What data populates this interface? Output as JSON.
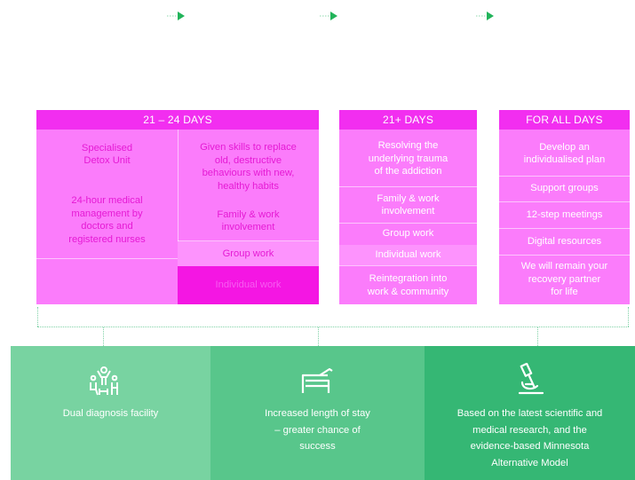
{
  "colors": {
    "header_pink": "#f22ef0",
    "cell_pink": "#fb7cfb",
    "cell_pink_alt": "#fd93fd",
    "hot_pink": "#f416e3",
    "text_magenta": "#e51ad4",
    "arrow_green": "#22b45a",
    "panel_1": "#78d3a1",
    "panel_2": "#58c68b",
    "panel_3": "#35b774"
  },
  "col1": {
    "header": "21 – 24 DAYS",
    "left_top": "Specialised\nDetox Unit",
    "left_mid": "24-hour medical\nmanagement by\ndoctors and\nregistered nurses",
    "right_top": "Given skills to replace\nold, destructive\nbehaviours with new,\nhealthy habits",
    "right_mid": "Family & work\ninvolvement",
    "right_group": "Group work",
    "right_individual": "Individual work"
  },
  "col2": {
    "header": "21+ DAYS",
    "items": [
      "Resolving the\nunderlying trauma\nof the addiction",
      "Family & work\ninvolvement",
      "Group work",
      "Individual work",
      "Reintegration into\nwork & community"
    ]
  },
  "col3": {
    "header": "FOR ALL DAYS",
    "items": [
      "Develop an\nindividualised plan",
      "Support groups",
      "12-step meetings",
      "Digital resources",
      "We will remain your\nrecovery partner\nfor life"
    ]
  },
  "panels": [
    {
      "icon": "people-diagnosis-icon",
      "text": "Dual diagnosis facility"
    },
    {
      "icon": "bed-icon",
      "text": "Increased length of stay\n– greater chance of\nsuccess"
    },
    {
      "icon": "microscope-icon",
      "text": "Based on the latest scientific and\nmedical research, and the\nevidence-based Minnesota\nAlternative Model"
    }
  ]
}
